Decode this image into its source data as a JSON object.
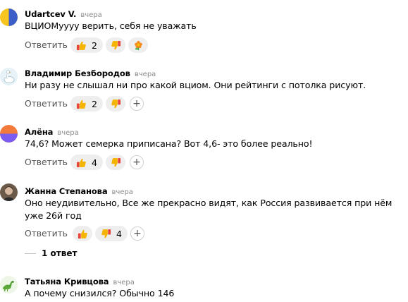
{
  "reply_label": "Ответить",
  "add_reaction_label": "+",
  "comments": [
    {
      "author": "Udartcev V.",
      "time": "вчера",
      "text": "ВЦИОМуууу верить, себя не уважать",
      "likes": "2",
      "dislikes": "",
      "avatar": "yellow-blue-half-circle",
      "extra_reaction": "flower-emoji"
    },
    {
      "author": "Владимир Безбородов",
      "time": "вчера",
      "text": "Ни разу не слышал ни про какой вциом. Они рейтинги с потолка рисуют.",
      "likes": "2",
      "dislikes": "",
      "avatar": "goose-illustration"
    },
    {
      "author": "Алёна",
      "time": "вчера",
      "text": "74,6? Может семерка приписана? Вот 4,6- это более реально!",
      "likes": "4",
      "dislikes": "",
      "avatar": "orange-purple-half-circle"
    },
    {
      "author": "Жанна Степанова",
      "time": "вчера",
      "text": "Оно неудивительно, Все же прекрасно видят, как Россия развивается при нём уже 26й год",
      "likes": "",
      "dislikes": "4",
      "avatar": "photo",
      "thread_label": "1 ответ"
    },
    {
      "author": "Татьяна Кривцова",
      "time": "вчера",
      "text": "А почему снизился? Обычно 146",
      "avatar": "dinosaur-illustration"
    }
  ],
  "colors": {
    "reaction_bg": "#eeeeee",
    "meta_gray": "#8a8a8a",
    "reply_gray": "#555555",
    "thumb_yellow": "#f5b400",
    "sleeve_red": "#e8463b"
  }
}
